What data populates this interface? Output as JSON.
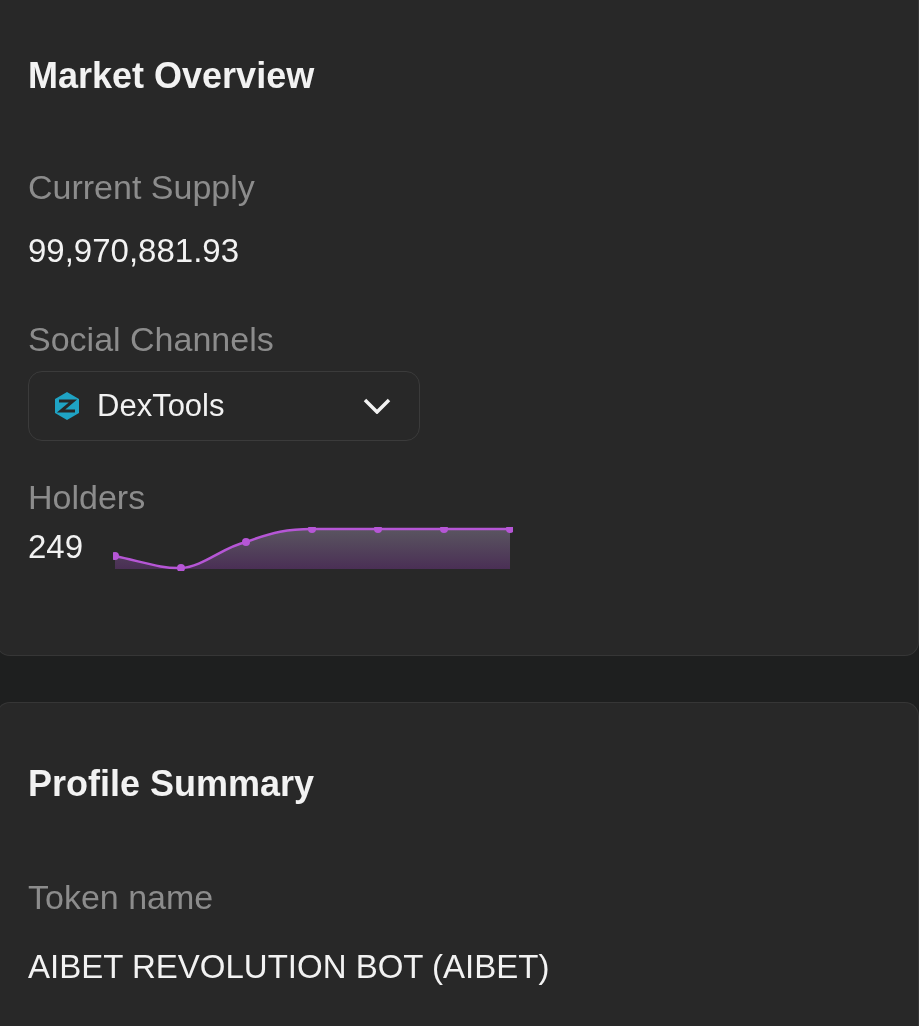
{
  "market_overview": {
    "title": "Market Overview",
    "current_supply": {
      "label": "Current Supply",
      "value": "99,970,881.93"
    },
    "social_channels": {
      "label": "Social Channels",
      "selected_channel": "DexTools"
    },
    "holders": {
      "label": "Holders",
      "value": "249"
    }
  },
  "profile_summary": {
    "title": "Profile Summary",
    "token_name": {
      "label": "Token name",
      "value": "AIBET REVOLUTION BOT (AIBET)"
    }
  }
}
